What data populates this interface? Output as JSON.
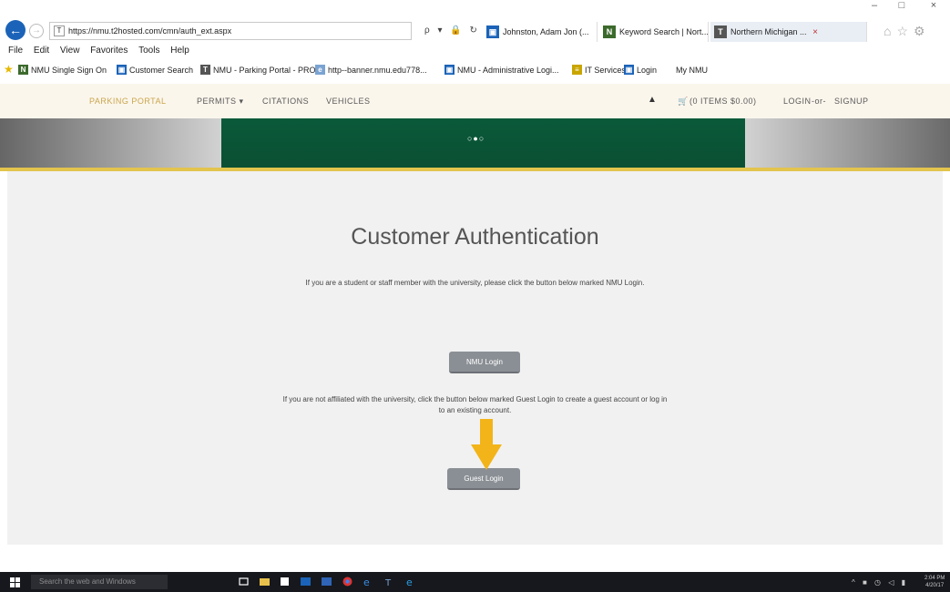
{
  "window": {
    "minimize": "–",
    "maximize": "□",
    "close": "×"
  },
  "address_bar": {
    "url": "https://nmu.t2hosted.com/cmn/auth_ext.aspx",
    "tools": "ρ ▾ 🔒 ↻",
    "tabs": [
      {
        "label": "Johnston, Adam Jon (...",
        "icon": "contact-icon",
        "icon_color": "#1b63b8"
      },
      {
        "label": "Keyword Search | Nort...",
        "icon": "nmu-icon",
        "icon_color": "#3c6a2c"
      },
      {
        "label": "Northern Michigan ...",
        "icon": "page-icon",
        "icon_color": "#555555",
        "close": "×"
      }
    ]
  },
  "menu": [
    "File",
    "Edit",
    "View",
    "Favorites",
    "Tools",
    "Help"
  ],
  "favorites": [
    {
      "label": "NMU Single Sign On",
      "icon": "nmu-icon",
      "color": "#3c6a2c"
    },
    {
      "label": "Customer Search",
      "icon": "contact-icon",
      "color": "#1b63b8"
    },
    {
      "label": "NMU - Parking Portal - PRO...",
      "icon": "page-icon",
      "color": "#555555"
    },
    {
      "label": "http--banner.nmu.edu778...",
      "icon": "page-icon",
      "color": "#7aa3d2"
    },
    {
      "label": "NMU - Administrative Logi...",
      "icon": "contact-icon",
      "color": "#1b63b8"
    },
    {
      "label": "IT Services",
      "icon": "it-icon",
      "color": "#c9a500"
    },
    {
      "label": "Login",
      "icon": "contact-icon",
      "color": "#1b63b8"
    },
    {
      "label": "My NMU",
      "icon": "none",
      "color": "#ffffff"
    }
  ],
  "site_nav": {
    "brand": "PARKING PORTAL",
    "permits": "PERMITS ▾",
    "citations": "CITATIONS",
    "vehicles": "VEHICLES",
    "cart": "(0 ITEMS $0.00)",
    "login": "LOGIN",
    "or": "-or-",
    "signup": "SIGNUP"
  },
  "banner": {
    "dots": "○●○"
  },
  "content": {
    "heading": "Customer Authentication",
    "student_text": "If you are a student or staff member with the university, please click the button below marked NMU Login.",
    "nmu_login": "NMU Login",
    "guest_text_1": "If you are not affiliated with the university, click the button below marked Guest Login to create a guest account or log in",
    "guest_text_2": "to an existing account.",
    "guest_login": "Guest Login"
  },
  "taskbar": {
    "search_placeholder": "Search the web and Windows",
    "tray": "^ ■ ◷ ◁ ▮",
    "clock_time": "2:04 PM",
    "clock_date": "4/20/17"
  },
  "colors": {
    "banner_green": "#0b5637",
    "gold": "#e3c44d",
    "button_gray": "#8a8f95",
    "arrow": "#f2b418"
  }
}
